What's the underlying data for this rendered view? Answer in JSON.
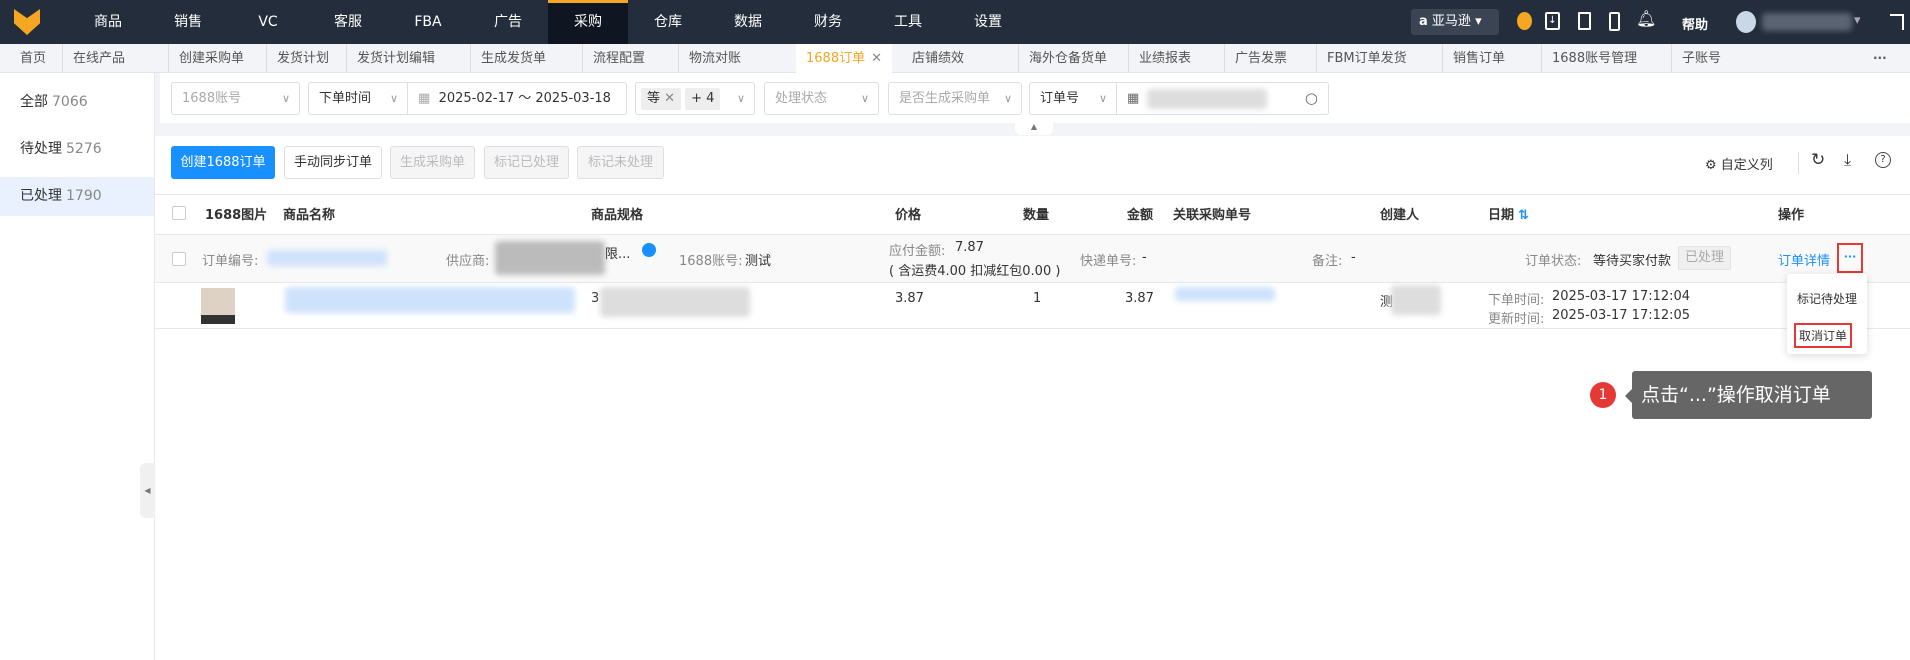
{
  "topnav": {
    "items": [
      "商品",
      "销售",
      "VC",
      "客服",
      "FBA",
      "广告",
      "采购",
      "仓库",
      "数据",
      "财务",
      "工具",
      "设置"
    ],
    "active": "采购",
    "marketplace": "亚马逊",
    "help": "帮助",
    "accent": "#f5a623"
  },
  "tabs": {
    "items": [
      "首页",
      "在线产品",
      "创建采购单",
      "发货计划",
      "发货计划编辑",
      "生成发货单",
      "流程配置",
      "物流对账",
      "1688订单",
      "店铺绩效",
      "海外仓备货单",
      "业绩报表",
      "广告发票",
      "FBM订单发货",
      "销售订单",
      "1688账号管理",
      "子账号"
    ],
    "active": "1688订单",
    "more": "···"
  },
  "sidebar": {
    "items": [
      {
        "label": "全部",
        "count": "7066"
      },
      {
        "label": "待处理",
        "count": "5276"
      },
      {
        "label": "已处理",
        "count": "1790"
      }
    ],
    "active": "已处理"
  },
  "filters": {
    "account_placeholder": "1688账号",
    "time_type": "下单时间",
    "date_range": "2025-02-17 ～ 2025-03-18",
    "chip1": "等",
    "chip2": "+ 4",
    "status_placeholder": "处理状态",
    "generated_placeholder": "是否生成采购单",
    "search_type": "订单号"
  },
  "toolbar": {
    "create": "创建1688订单",
    "sync": "手动同步订单",
    "generate": "生成采购单",
    "mark_done": "标记已处理",
    "mark_undone": "标记未处理",
    "custom_columns": "自定义列"
  },
  "table": {
    "headers": [
      "1688图片",
      "商品名称",
      "商品规格",
      "价格",
      "数量",
      "金额",
      "关联采购单号",
      "创建人",
      "日期",
      "操作"
    ],
    "order": {
      "order_no_label": "订单编号:",
      "supplier_label": "供应商:",
      "supplier_suffix": "限...",
      "account_label": "1688账号:",
      "account": "测试",
      "payable_label": "应付金额:",
      "payable": "7.87",
      "payable_detail": "( 含运费4.00 扣减红包0.00 )",
      "express_label": "快递单号:",
      "express": "-",
      "remark_label": "备注:",
      "remark": "-",
      "status_label": "订单状态:",
      "status": "等待买家付款",
      "processed_tag": "已处理",
      "detail_link": "订单详情",
      "more": "···"
    },
    "item": {
      "spec_prefix": "3",
      "price": "3.87",
      "qty": "1",
      "amount": "3.87",
      "creator_prefix": "测",
      "order_time_label": "下单时间:",
      "order_time": "2025-03-17 17:12:04",
      "update_time_label": "更新时间:",
      "update_time": "2025-03-17 17:12:05"
    }
  },
  "dropdown": {
    "items": [
      "标记待处理",
      "取消订单"
    ]
  },
  "tooltip": {
    "step": "1",
    "text": "点击“...”操作取消订单"
  },
  "colors": {
    "primary": "#1890ff",
    "highlight": "#e53935",
    "nav_bg": "#232d3b"
  }
}
